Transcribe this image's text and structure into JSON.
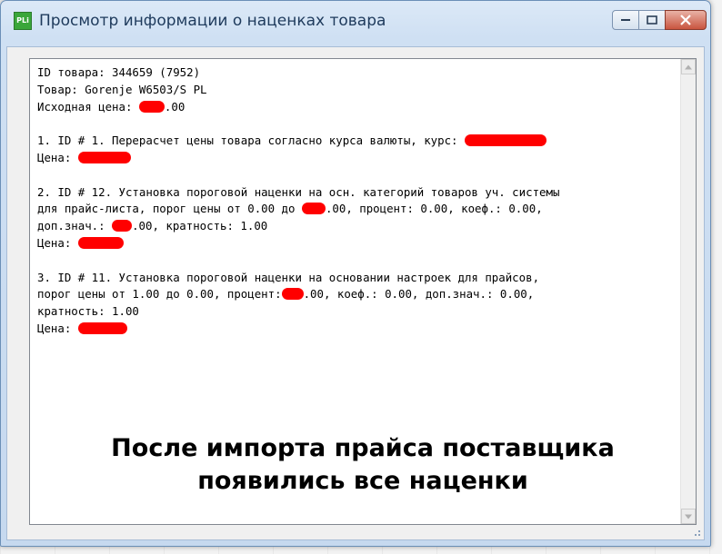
{
  "window": {
    "title": "Просмотр информации о наценках товара",
    "icon_text": "PLi",
    "controls": [
      "minimize-icon",
      "maximize-icon",
      "close-icon"
    ]
  },
  "info": {
    "lines": [
      "ID товара: 344659 (7952)",
      "Товар: Gorenje W6503/S PL",
      "Исходная цена: ",
      "",
      "1. ID # 1. Перерасчет цены товара согласно курса валюты, курс: ",
      "Цена: ",
      "",
      "2. ID # 12. Установка пороговой наценки на осн. категорий товаров уч. системы",
      "для прайс-листа, порог цены от 0.00 до ",
      "доп.знач.: ",
      "Цена: ",
      "",
      "3. ID # 11. Установка пороговой наценки на основании настроек для прайсов,",
      "порог цены от 1.00 до 0.00, процент:",
      "кратность: 1.00",
      "Цена: "
    ],
    "line3_tail": ".00",
    "line9_tail": ".00, процент: 0.00, коеф.: 0.00,",
    "line10_tail": ".00, кратность: 1.00",
    "line14_tail": ".00, коеф.: 0.00, доп.знач.: 0.00,"
  },
  "caption": {
    "line1": "После импорта прайса поставщика",
    "line2": "появились все наценки"
  },
  "colors": {
    "redaction": "#ff0000",
    "title_text": "#1e3a5c"
  }
}
